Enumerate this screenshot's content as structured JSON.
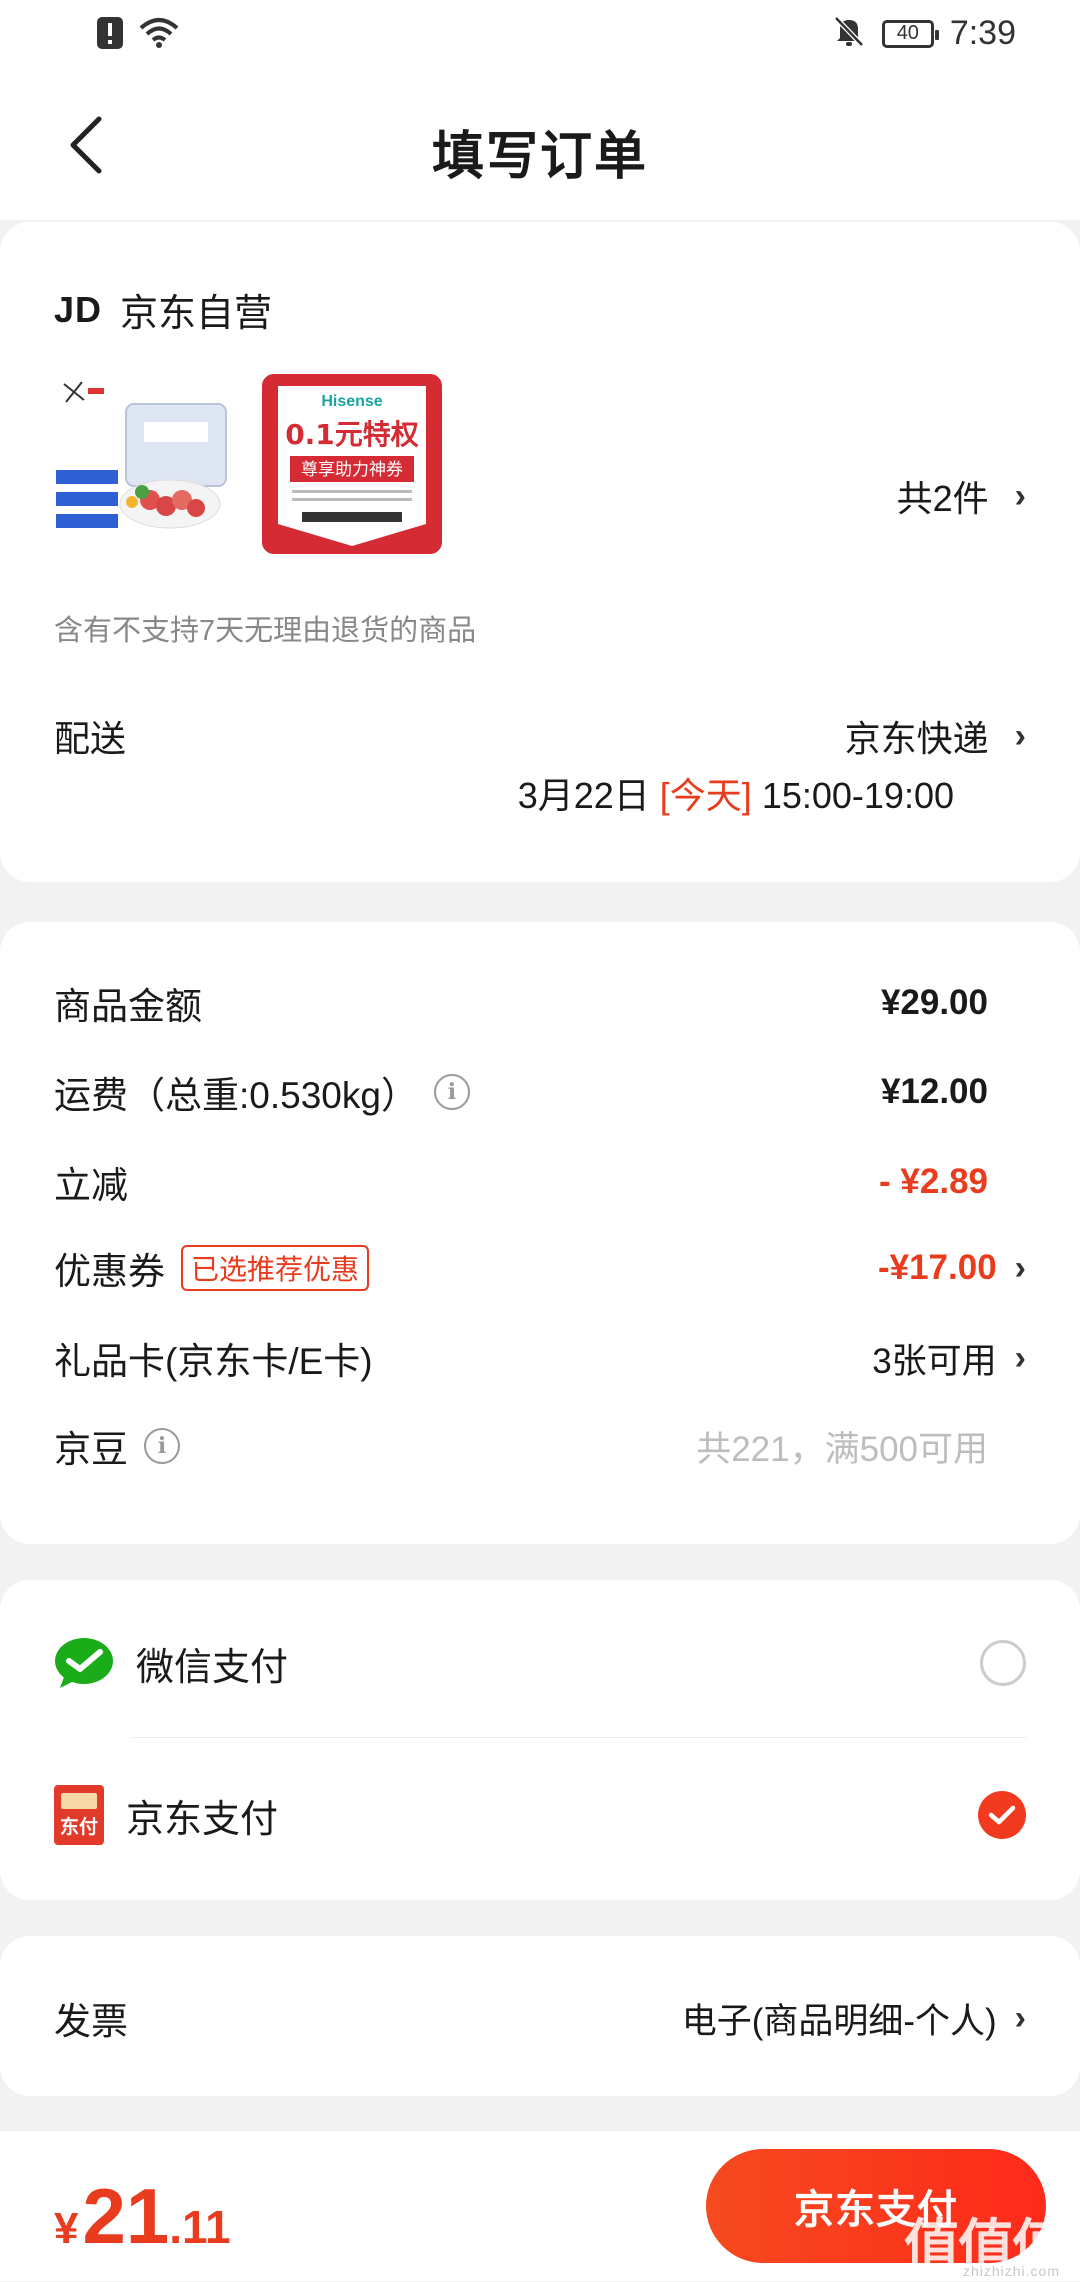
{
  "status_bar": {
    "time": "7:39",
    "battery": "40"
  },
  "header": {
    "title": "填写订单"
  },
  "order": {
    "shop_logo": "JD",
    "shop_name": "京东自营",
    "item_count": "共2件",
    "coupon_thumb": {
      "brand": "Hisense",
      "headline": "0.1元特权",
      "sub": "尊享助力神券"
    },
    "return_note": "含有不支持7天无理由退货的商品",
    "shipping": {
      "label": "配送",
      "carrier": "京东快递",
      "date": "3月22日",
      "today": "[今天]",
      "window": "15:00-19:00"
    }
  },
  "fees": {
    "goods": {
      "label": "商品金额",
      "value": "¥29.00"
    },
    "freight": {
      "label": "运费（总重:0.530kg）",
      "value": "¥12.00"
    },
    "discount": {
      "label": "立减",
      "value": "- ¥2.89"
    },
    "coupon": {
      "label": "优惠券",
      "tag": "已选推荐优惠",
      "value": "-¥17.00"
    },
    "giftcard": {
      "label": "礼品卡(京东卡/E卡)",
      "value": "3张可用"
    },
    "jingdou": {
      "label": "京豆",
      "value": "共221，满500可用"
    }
  },
  "payment": {
    "wechat": {
      "label": "微信支付",
      "selected": false
    },
    "jdpay": {
      "label": "京东支付",
      "icon_text": "东付",
      "selected": true
    }
  },
  "invoice": {
    "label": "发票",
    "value": "电子(商品明细-个人)"
  },
  "bottom": {
    "currency": "¥",
    "total_int": "21",
    "total_dec": ".11",
    "pay_button": "京东支付",
    "watermark": "值值值",
    "watermark_sub": "zhizhizhi.com"
  },
  "colors": {
    "accent": "#e93b1d",
    "wechat_green": "#1aad19"
  }
}
